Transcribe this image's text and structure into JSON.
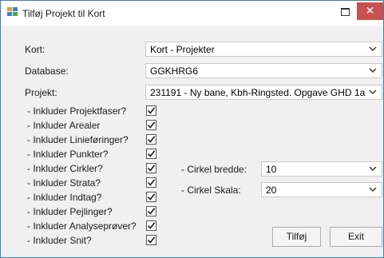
{
  "window": {
    "title": "Tilføj Projekt til Kort",
    "close_glyph": "✕"
  },
  "fields": {
    "kort": {
      "label": "Kort:",
      "value": "Kort - Projekter"
    },
    "database": {
      "label": "Database:",
      "value": "GGKHRG6"
    },
    "projekt": {
      "label": "Projekt:",
      "value": "231191 - Ny bane, Kbh-Ringsted. Opgave GHD 1a"
    }
  },
  "options": [
    {
      "label": "- Inkluder Projektfaser?",
      "checked": true
    },
    {
      "label": "- Inkluder Arealer",
      "checked": true
    },
    {
      "label": "- Inkluder Linieføringer?",
      "checked": true
    },
    {
      "label": "- Inkluder Punkter?",
      "checked": true
    },
    {
      "label": "- Inkluder Cirkler?",
      "checked": true
    },
    {
      "label": "- Inkluder Strata?",
      "checked": true
    },
    {
      "label": "- Inkluder Indtag?",
      "checked": true
    },
    {
      "label": "- Inkluder Pejlinger?",
      "checked": true
    },
    {
      "label": "- Inkluder Analyseprøver?",
      "checked": true
    },
    {
      "label": "- Inkluder Snit?",
      "checked": true
    }
  ],
  "circle": {
    "width": {
      "label": "- Cirkel bredde:",
      "value": "10"
    },
    "scale": {
      "label": "- Cirkel Skala:",
      "value": "20"
    }
  },
  "buttons": {
    "add": "Tilføj",
    "exit": "Exit"
  }
}
